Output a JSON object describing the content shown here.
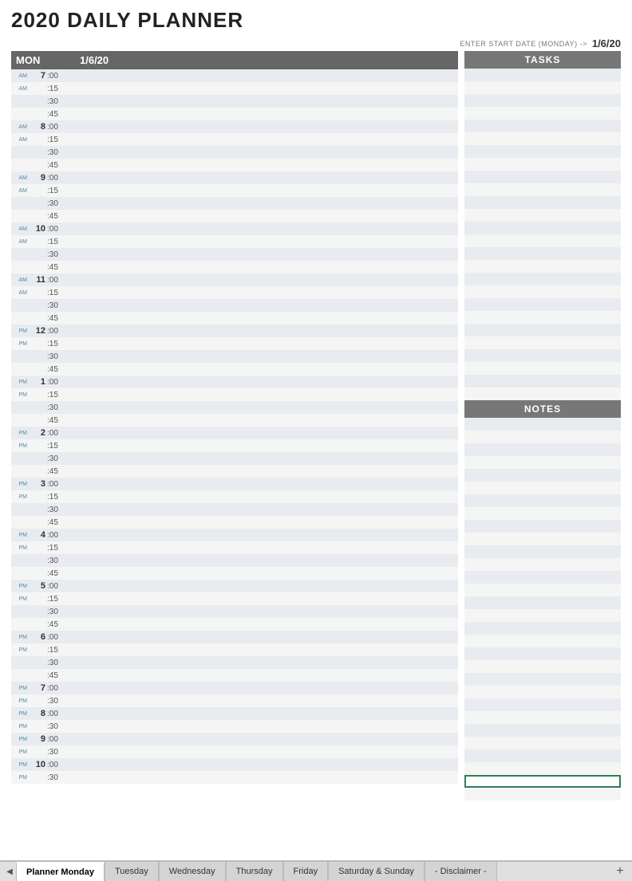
{
  "title": "2020 DAILY PLANNER",
  "date_entry": {
    "label": "ENTER START DATE (MONDAY) ->",
    "value": "1/6/20"
  },
  "schedule": {
    "day_header": "MON",
    "date_header": "1/6/20",
    "time_slots": [
      {
        "hour": "7",
        "ampm": "AM",
        "minute": ":00"
      },
      {
        "hour": "",
        "ampm": "AM",
        "minute": ":15"
      },
      {
        "hour": "",
        "ampm": "",
        "minute": ":30"
      },
      {
        "hour": "",
        "ampm": "",
        "minute": ":45"
      },
      {
        "hour": "8",
        "ampm": "AM",
        "minute": ":00"
      },
      {
        "hour": "",
        "ampm": "AM",
        "minute": ":15"
      },
      {
        "hour": "",
        "ampm": "",
        "minute": ":30"
      },
      {
        "hour": "",
        "ampm": "",
        "minute": ":45"
      },
      {
        "hour": "9",
        "ampm": "AM",
        "minute": ":00"
      },
      {
        "hour": "",
        "ampm": "AM",
        "minute": ":15"
      },
      {
        "hour": "",
        "ampm": "",
        "minute": ":30"
      },
      {
        "hour": "",
        "ampm": "",
        "minute": ":45"
      },
      {
        "hour": "10",
        "ampm": "AM",
        "minute": ":00"
      },
      {
        "hour": "",
        "ampm": "AM",
        "minute": ":15"
      },
      {
        "hour": "",
        "ampm": "",
        "minute": ":30"
      },
      {
        "hour": "",
        "ampm": "",
        "minute": ":45"
      },
      {
        "hour": "11",
        "ampm": "AM",
        "minute": ":00"
      },
      {
        "hour": "",
        "ampm": "AM",
        "minute": ":15"
      },
      {
        "hour": "",
        "ampm": "",
        "minute": ":30"
      },
      {
        "hour": "",
        "ampm": "",
        "minute": ":45"
      },
      {
        "hour": "12",
        "ampm": "PM",
        "minute": ":00"
      },
      {
        "hour": "",
        "ampm": "PM",
        "minute": ":15"
      },
      {
        "hour": "",
        "ampm": "",
        "minute": ":30"
      },
      {
        "hour": "",
        "ampm": "",
        "minute": ":45"
      },
      {
        "hour": "1",
        "ampm": "PM",
        "minute": ":00"
      },
      {
        "hour": "",
        "ampm": "PM",
        "minute": ":15"
      },
      {
        "hour": "",
        "ampm": "",
        "minute": ":30"
      },
      {
        "hour": "",
        "ampm": "",
        "minute": ":45"
      },
      {
        "hour": "2",
        "ampm": "PM",
        "minute": ":00"
      },
      {
        "hour": "",
        "ampm": "PM",
        "minute": ":15"
      },
      {
        "hour": "",
        "ampm": "",
        "minute": ":30"
      },
      {
        "hour": "",
        "ampm": "",
        "minute": ":45"
      },
      {
        "hour": "3",
        "ampm": "PM",
        "minute": ":00"
      },
      {
        "hour": "",
        "ampm": "PM",
        "minute": ":15"
      },
      {
        "hour": "",
        "ampm": "",
        "minute": ":30"
      },
      {
        "hour": "",
        "ampm": "",
        "minute": ":45"
      },
      {
        "hour": "4",
        "ampm": "PM",
        "minute": ":00"
      },
      {
        "hour": "",
        "ampm": "PM",
        "minute": ":15"
      },
      {
        "hour": "",
        "ampm": "",
        "minute": ":30"
      },
      {
        "hour": "",
        "ampm": "",
        "minute": ":45"
      },
      {
        "hour": "5",
        "ampm": "PM",
        "minute": ":00"
      },
      {
        "hour": "",
        "ampm": "PM",
        "minute": ":15"
      },
      {
        "hour": "",
        "ampm": "",
        "minute": ":30"
      },
      {
        "hour": "",
        "ampm": "",
        "minute": ":45"
      },
      {
        "hour": "6",
        "ampm": "PM",
        "minute": ":00"
      },
      {
        "hour": "",
        "ampm": "PM",
        "minute": ":15"
      },
      {
        "hour": "",
        "ampm": "",
        "minute": ":30"
      },
      {
        "hour": "",
        "ampm": "",
        "minute": ":45"
      },
      {
        "hour": "7",
        "ampm": "PM",
        "minute": ":00"
      },
      {
        "hour": "",
        "ampm": "PM",
        "minute": ":30"
      },
      {
        "hour": "8",
        "ampm": "PM",
        "minute": ":00"
      },
      {
        "hour": "",
        "ampm": "PM",
        "minute": ":30"
      },
      {
        "hour": "9",
        "ampm": "PM",
        "minute": ":00"
      },
      {
        "hour": "",
        "ampm": "PM",
        "minute": ":30"
      },
      {
        "hour": "10",
        "ampm": "PM",
        "minute": ":00"
      },
      {
        "hour": "",
        "ampm": "PM",
        "minute": ":30"
      }
    ]
  },
  "tasks": {
    "header": "TASKS",
    "count": 26
  },
  "notes": {
    "header": "NOTES",
    "count": 30,
    "active_row": 28
  },
  "tabs": [
    {
      "label": "Planner Monday",
      "active": true
    },
    {
      "label": "Tuesday",
      "active": false
    },
    {
      "label": "Wednesday",
      "active": false
    },
    {
      "label": "Thursday",
      "active": false
    },
    {
      "label": "Friday",
      "active": false
    },
    {
      "label": "Saturday & Sunday",
      "active": false
    },
    {
      "label": "- Disclaimer -",
      "active": false
    }
  ],
  "tab_add_label": "+"
}
